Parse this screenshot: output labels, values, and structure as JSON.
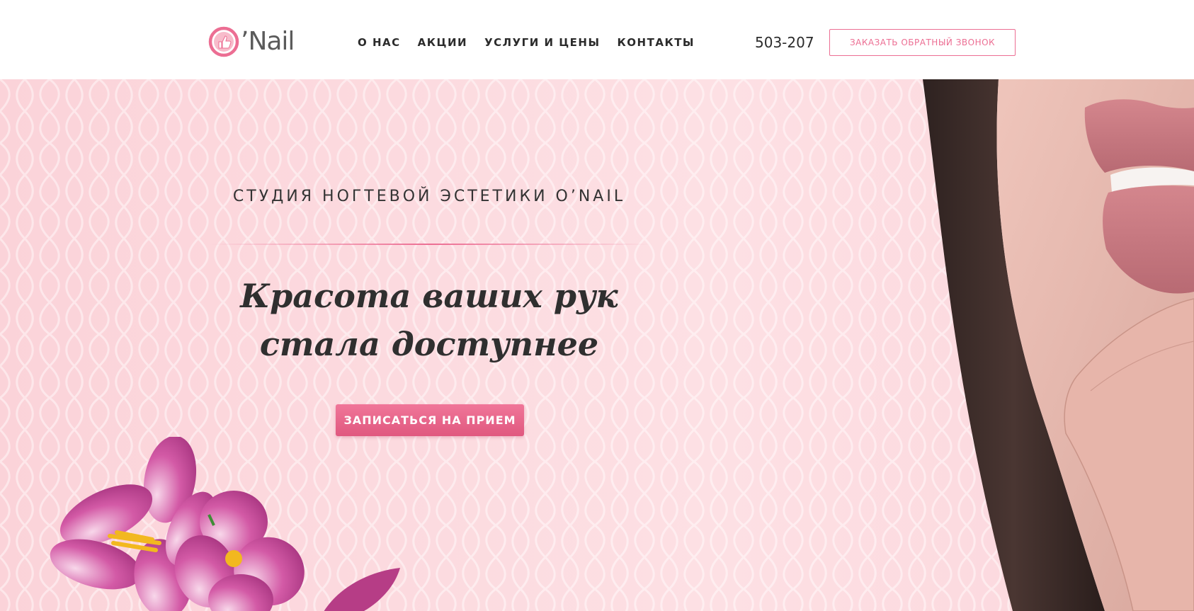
{
  "header": {
    "logo": {
      "prefix": "O",
      "text": "’Nail"
    },
    "nav": [
      "О НАС",
      "АКЦИИ",
      "УСЛУГИ И ЦЕНЫ",
      "КОНТАКТЫ"
    ],
    "phone": "503-207",
    "callback_label": "ЗАКАЗАТЬ ОБРАТНЫЙ ЗВОНОК"
  },
  "hero": {
    "subtitle": "СТУДИЯ НОГТЕВОЙ ЭСТЕТИКИ O’NAIL",
    "headline_line1": "Красота ваших рук",
    "headline_line2": "стала доступнее",
    "cta_label": "ЗАПИСАТЬСЯ НА ПРИЕМ"
  },
  "colors": {
    "accent": "#ec6e93",
    "hero_background": "#fcd8dd",
    "text_dark": "#2b2b2b"
  },
  "icons": {
    "logo": "thumbs-up-circle-icon"
  }
}
